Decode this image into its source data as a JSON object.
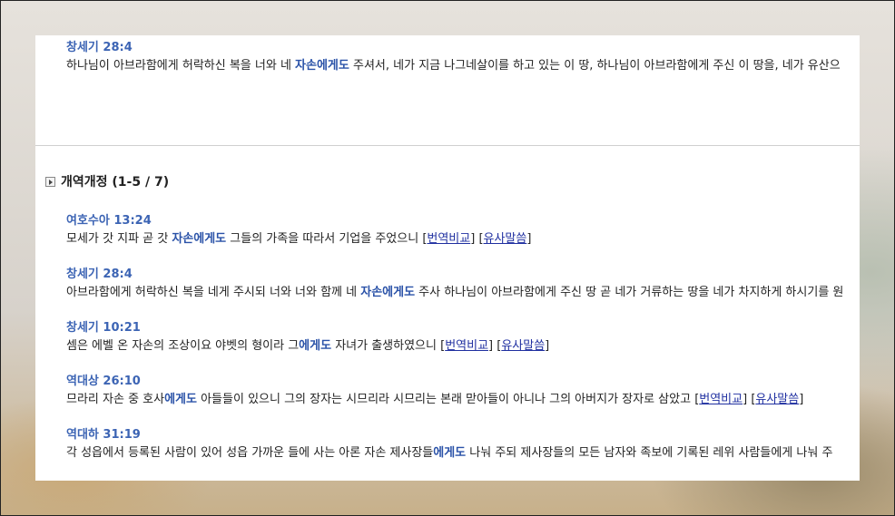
{
  "top_entry": {
    "ref": "창세기 28:4",
    "before": "하나님이 아브라함에게 허락하신 복을 너와 네 ",
    "highlight": "자손에게도",
    "after": " 주셔서, 네가 지금 나그네살이를 하고 있는 이 땅, 하나님이 아브라함에게 주신 이 땅을, 네가 유산으"
  },
  "section": {
    "title": "개역개정 (1-5 / 7)"
  },
  "links": {
    "compare": "번역비교",
    "similar": "유사말씀"
  },
  "entries": [
    {
      "ref": "여호수아 13:24",
      "before": "모세가 갓 지파 곧 갓 ",
      "highlight": "자손에게도",
      "after": " 그들의 가족을 따라서 기업을 주었으니 "
    },
    {
      "ref": "창세기 28:4",
      "before": "아브라함에게 허락하신 복을 네게 주시되 너와 너와 함께 네 ",
      "highlight": "자손에게도",
      "after": " 주사 하나님이 아브라함에게 주신 땅 곧 네가 거류하는 땅을 네가 차지하게 하시기를 원"
    },
    {
      "ref": "창세기 10:21",
      "before": "셈은 에벨 온 자손의 조상이요 야벳의 형이라 그",
      "highlight": "에게도",
      "after": " 자녀가 출생하였으니 "
    },
    {
      "ref": "역대상 26:10",
      "before": "므라리 자손 중 호사",
      "highlight": "에게도",
      "after": " 아들들이 있으니 그의 장자는 시므리라 시므리는 본래 맏아들이 아니나 그의 아버지가 장자로 삼았고 "
    },
    {
      "ref": "역대하 31:19",
      "before": "각 성읍에서 등록된 사람이 있어 성읍 가까운 들에 사는 아론 자손 제사장들",
      "highlight": "에게도",
      "after": " 나눠 주되 제사장들의 모든 남자와 족보에 기록된 레위 사람들에게 나눠 주"
    }
  ]
}
